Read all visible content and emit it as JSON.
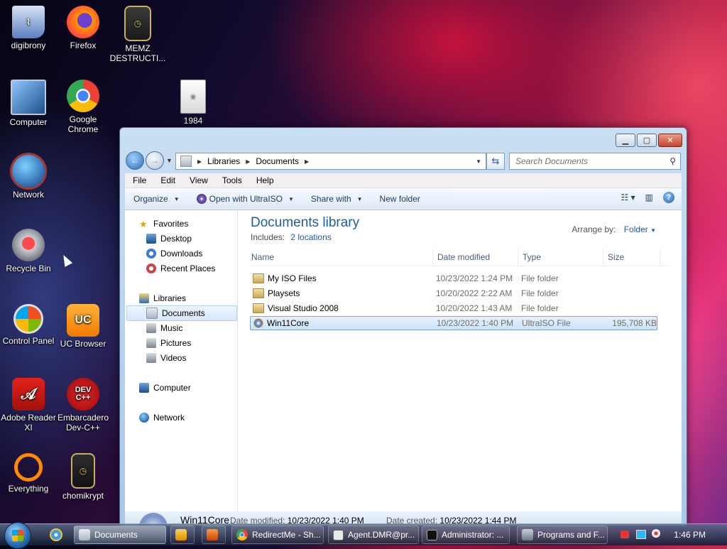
{
  "desktop": {
    "icons": [
      {
        "label": "digibrony"
      },
      {
        "label": "Firefox"
      },
      {
        "label": "MEMZ DESTRUCTI..."
      },
      {
        "label": "Computer"
      },
      {
        "label": "Google Chrome"
      },
      {
        "label": "1984"
      },
      {
        "label": "Network"
      },
      {
        "label": "Recycle Bin"
      },
      {
        "label": "Control Panel"
      },
      {
        "label": "UC Browser"
      },
      {
        "label": "Adobe Reader XI"
      },
      {
        "label": "Embarcadero Dev-C++"
      },
      {
        "label": "Everything"
      },
      {
        "label": "chomikrypt"
      }
    ]
  },
  "window": {
    "address": {
      "crumbs": [
        "Libraries",
        "Documents"
      ]
    },
    "search": {
      "placeholder": "Search Documents"
    },
    "menu": [
      "File",
      "Edit",
      "View",
      "Tools",
      "Help"
    ],
    "commands": {
      "organize": "Organize",
      "open_with": "Open with UltraISO",
      "share_with": "Share with",
      "new_folder": "New folder"
    },
    "nav": {
      "favorites": "Favorites",
      "desktop": "Desktop",
      "downloads": "Downloads",
      "recent": "Recent Places",
      "libraries": "Libraries",
      "documents": "Documents",
      "music": "Music",
      "pictures": "Pictures",
      "videos": "Videos",
      "computer": "Computer",
      "network": "Network"
    },
    "library": {
      "title": "Documents library",
      "includes_label": "Includes:",
      "locations": "2 locations",
      "arrange_label": "Arrange by:",
      "arrange_value": "Folder"
    },
    "columns": {
      "name": "Name",
      "date": "Date modified",
      "type": "Type",
      "size": "Size"
    },
    "files": [
      {
        "name": "My ISO Files",
        "date": "10/23/2022 1:24 PM",
        "type": "File folder",
        "size": ""
      },
      {
        "name": "Playsets",
        "date": "10/20/2022 2:22 AM",
        "type": "File folder",
        "size": ""
      },
      {
        "name": "Visual Studio 2008",
        "date": "10/20/2022 1:43 AM",
        "type": "File folder",
        "size": ""
      },
      {
        "name": "Win11Core",
        "date": "10/23/2022 1:40 PM",
        "type": "UltraISO File",
        "size": "195,708 KB"
      }
    ],
    "details": {
      "name": "Win11Core",
      "modified_label": "Date modified:",
      "modified": "10/23/2022 1:40 PM",
      "created_label": "Date created:",
      "created": "10/23/2022 1:44 PM"
    }
  },
  "taskbar": {
    "items": [
      {
        "label": "Documents"
      },
      {
        "label": "RedirectMe - Sh..."
      },
      {
        "label": "Agent.DMR@pr..."
      },
      {
        "label": "Administrator: ..."
      },
      {
        "label": "Programs and F..."
      }
    ],
    "clock": "1:46 PM"
  }
}
